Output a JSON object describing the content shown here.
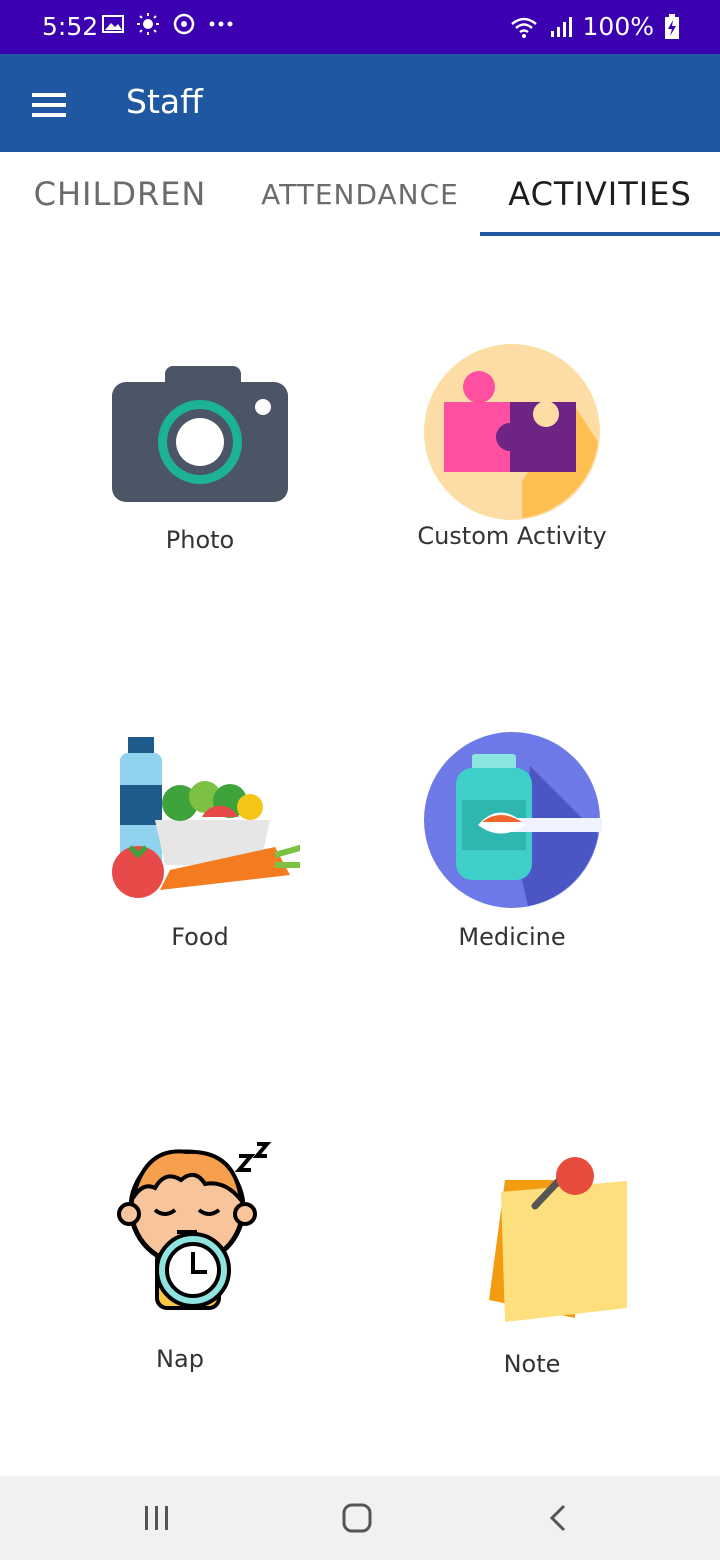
{
  "status_bar": {
    "time": "5:52",
    "battery": "100%"
  },
  "app_bar": {
    "title": "Staff"
  },
  "tabs": [
    {
      "label": "CHILDREN"
    },
    {
      "label": "ATTENDANCE"
    },
    {
      "label": "ACTIVITIES"
    }
  ],
  "activities": [
    {
      "label": "Photo",
      "icon": "camera-icon"
    },
    {
      "label": "Custom Activity",
      "icon": "puzzle-icon"
    },
    {
      "label": "Food",
      "icon": "food-icon"
    },
    {
      "label": "Medicine",
      "icon": "medicine-icon"
    },
    {
      "label": "Nap",
      "icon": "nap-icon"
    },
    {
      "label": "Note",
      "icon": "note-icon"
    }
  ],
  "colors": {
    "status_bar": "#3b00b0",
    "app_bar": "#1f58a0",
    "tab_indicator": "#1f58a0"
  }
}
